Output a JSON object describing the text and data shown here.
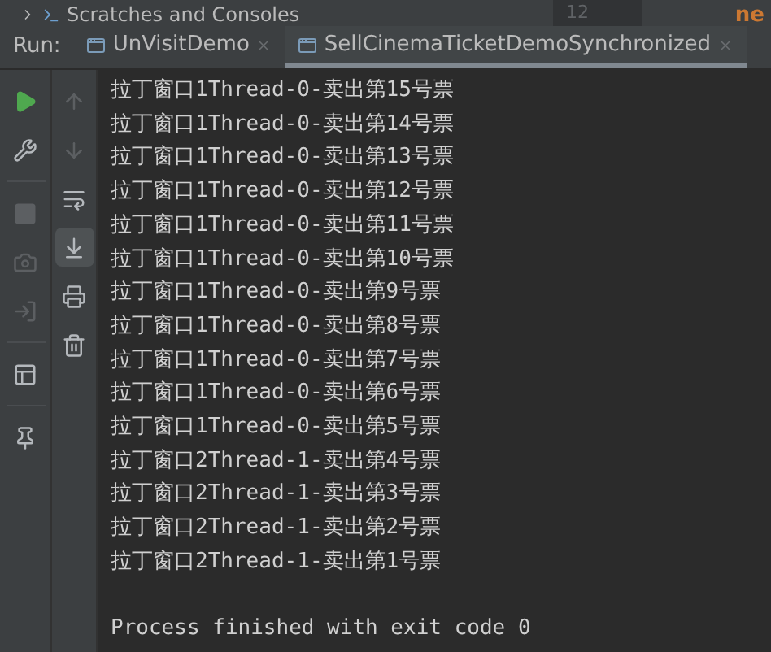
{
  "project_tree": {
    "item": "Scratches and Consoles",
    "line_number": "12",
    "editor_text": "ne"
  },
  "run_panel": {
    "label": "Run:",
    "tabs": [
      {
        "label": "UnVisitDemo",
        "selected": false
      },
      {
        "label": "SellCinemaTicketDemoSynchronized",
        "selected": true
      }
    ]
  },
  "left_toolbar": [
    {
      "kind": "play",
      "disabled": false
    },
    {
      "kind": "wrench",
      "disabled": false
    },
    {
      "kind": "separator"
    },
    {
      "kind": "stop",
      "disabled": true
    },
    {
      "kind": "camera",
      "disabled": true
    },
    {
      "kind": "login",
      "disabled": true
    },
    {
      "kind": "separator"
    },
    {
      "kind": "layout",
      "disabled": false
    },
    {
      "kind": "separator"
    },
    {
      "kind": "pin",
      "disabled": false
    }
  ],
  "right_toolbar": [
    {
      "kind": "up",
      "disabled": true,
      "selected": false
    },
    {
      "kind": "down",
      "disabled": true,
      "selected": false
    },
    {
      "kind": "wrap",
      "disabled": false,
      "selected": false
    },
    {
      "kind": "scroll-end",
      "disabled": false,
      "selected": true
    },
    {
      "kind": "print",
      "disabled": false,
      "selected": false
    },
    {
      "kind": "trash",
      "disabled": false,
      "selected": false
    }
  ],
  "console": {
    "lines": [
      "拉丁窗口1Thread-0-卖出第15号票",
      "拉丁窗口1Thread-0-卖出第14号票",
      "拉丁窗口1Thread-0-卖出第13号票",
      "拉丁窗口1Thread-0-卖出第12号票",
      "拉丁窗口1Thread-0-卖出第11号票",
      "拉丁窗口1Thread-0-卖出第10号票",
      "拉丁窗口1Thread-0-卖出第9号票",
      "拉丁窗口1Thread-0-卖出第8号票",
      "拉丁窗口1Thread-0-卖出第7号票",
      "拉丁窗口1Thread-0-卖出第6号票",
      "拉丁窗口1Thread-0-卖出第5号票",
      "拉丁窗口2Thread-1-卖出第4号票",
      "拉丁窗口2Thread-1-卖出第3号票",
      "拉丁窗口2Thread-1-卖出第2号票",
      "拉丁窗口2Thread-1-卖出第1号票"
    ],
    "exit_message": "Process finished with exit code 0"
  }
}
